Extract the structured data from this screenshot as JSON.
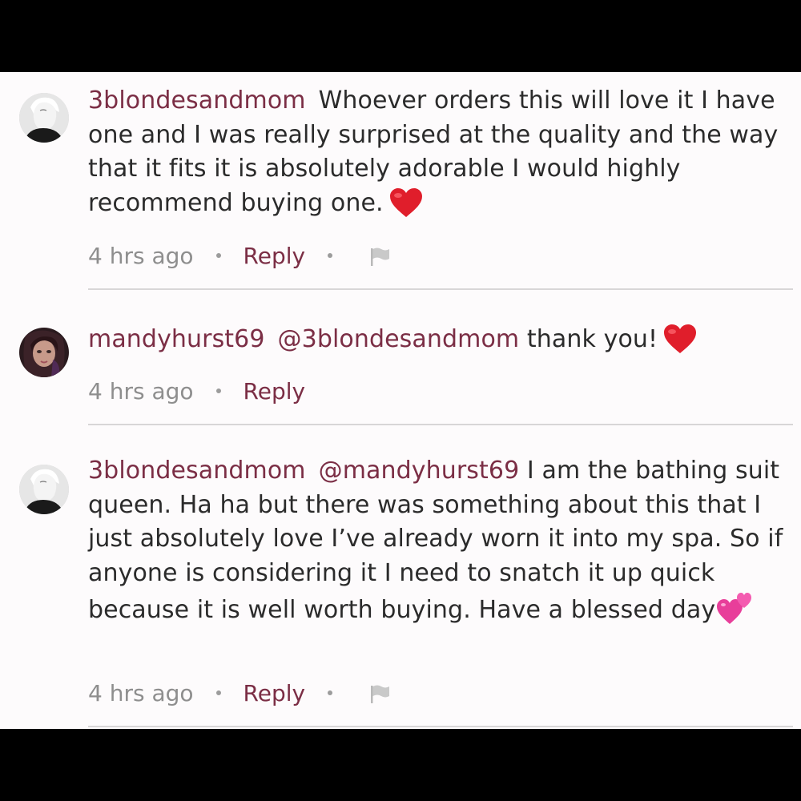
{
  "comments": [
    {
      "username": "3blondesandmom",
      "mention": "",
      "text": "Whoever orders this will love it I have one and I was really surprised at the quality and the way that it fits it is absolutely adorable I would highly recommend buying one.",
      "emoji": "red-heart",
      "time": "4 hrs ago",
      "reply_label": "Reply",
      "has_flag": true
    },
    {
      "username": "mandyhurst69",
      "mention": "@3blondesandmom",
      "text": "thank you!",
      "emoji": "red-heart",
      "time": "4 hrs ago",
      "reply_label": "Reply",
      "has_flag": false
    },
    {
      "username": "3blondesandmom",
      "mention": "@mandyhurst69",
      "text": "I am the bathing suit queen. Ha ha but there was something about this that I just absolutely love I’ve already worn it into my spa. So if anyone is considering it I need to snatch it up quick because it is well worth buying. Have a blessed day",
      "emoji": "two-hearts",
      "time": "4 hrs ago",
      "reply_label": "Reply",
      "has_flag": true
    }
  ],
  "colors": {
    "username": "#7b2e45",
    "body_text": "#2b2b2b",
    "meta_text": "#8e8e8e",
    "background": "#fdfbfc",
    "divider": "#d8d6d7",
    "letterbox": "#000000"
  }
}
